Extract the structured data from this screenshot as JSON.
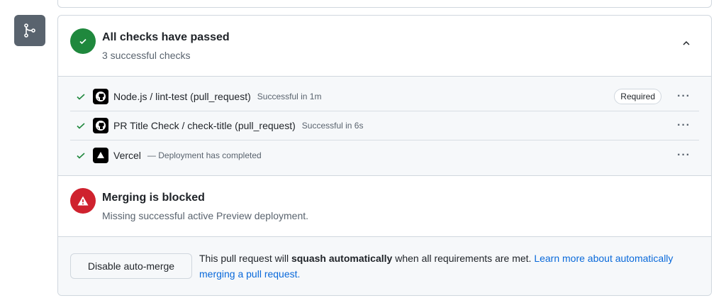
{
  "status": {
    "title": "All checks have passed",
    "subtitle": "3 successful checks"
  },
  "checks": [
    {
      "name": "Node.js / lint-test (pull_request)",
      "desc": "Successful in 1m",
      "badge": "Required",
      "icon": "github-icon"
    },
    {
      "name": "PR Title Check / check-title (pull_request)",
      "desc": "Successful in 6s",
      "icon": "github-icon"
    },
    {
      "name": "Vercel",
      "desc": "— Deployment has completed",
      "icon": "vercel-icon"
    }
  ],
  "blocked": {
    "title": "Merging is blocked",
    "subtitle": "Missing successful active Preview deployment."
  },
  "automerge": {
    "button": "Disable auto-merge",
    "text_before": "This pull request will ",
    "text_bold": "squash automatically",
    "text_after": " when all requirements are met. ",
    "link": "Learn more about automatically merging a pull request."
  },
  "colors": {
    "success": "#1f883d",
    "danger": "#cf222e",
    "link": "#0969da"
  }
}
